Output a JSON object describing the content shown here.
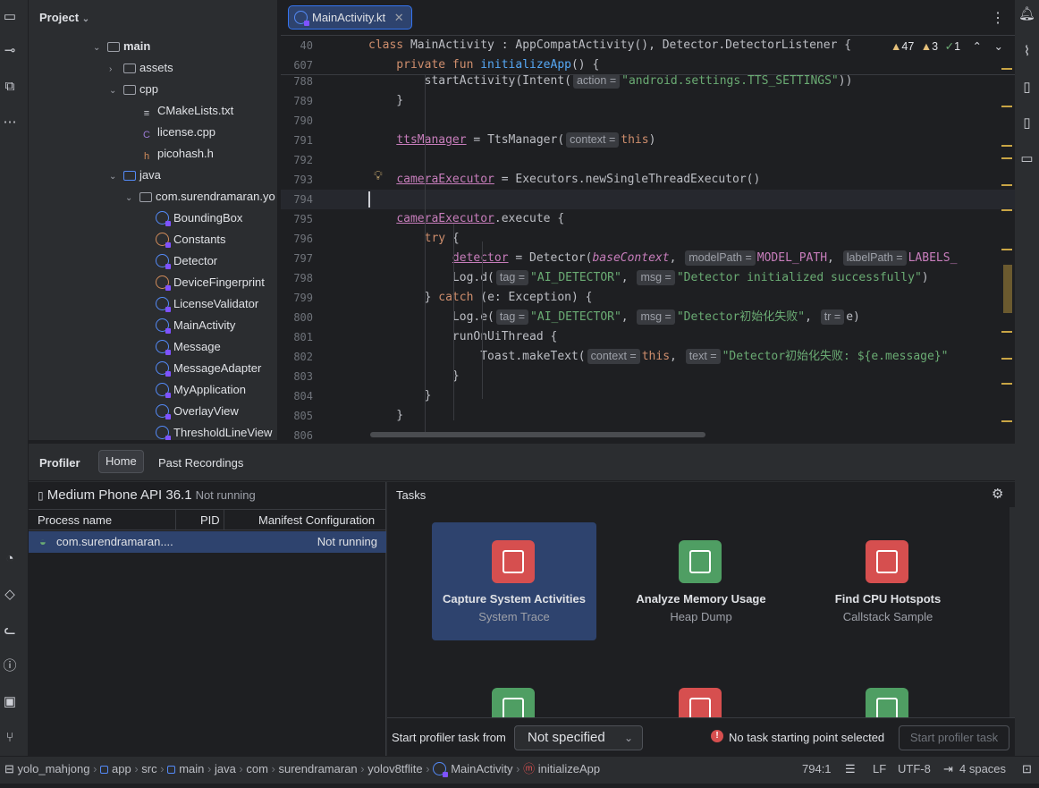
{
  "project_panel": {
    "title": "Project",
    "tree": [
      {
        "label": "main",
        "indent": 0,
        "arrow": "open",
        "icon": "module",
        "bold": true
      },
      {
        "label": "assets",
        "indent": 1,
        "arrow": "closed",
        "icon": "folder"
      },
      {
        "label": "cpp",
        "indent": 1,
        "arrow": "open",
        "icon": "folder"
      },
      {
        "label": "CMakeLists.txt",
        "indent": 2,
        "arrow": "",
        "icon": "text"
      },
      {
        "label": "license.cpp",
        "indent": 2,
        "arrow": "",
        "icon": "cpp"
      },
      {
        "label": "picohash.h",
        "indent": 2,
        "arrow": "",
        "icon": "header"
      },
      {
        "label": "java",
        "indent": 1,
        "arrow": "open",
        "icon": "folder-blue"
      },
      {
        "label": "com.surendramaran.yo",
        "indent": 2,
        "arrow": "open",
        "icon": "package"
      },
      {
        "label": "BoundingBox",
        "indent": 3,
        "arrow": "",
        "icon": "kotlin"
      },
      {
        "label": "Constants",
        "indent": 3,
        "arrow": "",
        "icon": "kotlin-object"
      },
      {
        "label": "Detector",
        "indent": 3,
        "arrow": "",
        "icon": "kotlin"
      },
      {
        "label": "DeviceFingerprint",
        "indent": 3,
        "arrow": "",
        "icon": "kotlin-object"
      },
      {
        "label": "LicenseValidator",
        "indent": 3,
        "arrow": "",
        "icon": "kotlin"
      },
      {
        "label": "MainActivity",
        "indent": 3,
        "arrow": "",
        "icon": "kotlin"
      },
      {
        "label": "Message",
        "indent": 3,
        "arrow": "",
        "icon": "kotlin"
      },
      {
        "label": "MessageAdapter",
        "indent": 3,
        "arrow": "",
        "icon": "kotlin"
      },
      {
        "label": "MyApplication",
        "indent": 3,
        "arrow": "",
        "icon": "kotlin"
      },
      {
        "label": "OverlayView",
        "indent": 3,
        "arrow": "",
        "icon": "kotlin"
      },
      {
        "label": "ThresholdLineView",
        "indent": 3,
        "arrow": "",
        "icon": "kotlin"
      }
    ]
  },
  "editor": {
    "tab_label": "MainActivity.kt",
    "inspections": {
      "warnings": "47",
      "weak_warnings": "3",
      "typos": "1"
    },
    "sticky": [
      {
        "num": "40",
        "parts": [
          [
            "kw",
            "class "
          ],
          [
            "cls",
            "MainActivity : AppCompatActivity(), Detector.DetectorListener {"
          ]
        ]
      },
      {
        "num": "607",
        "parts": [
          [
            "kw",
            "    private fun "
          ],
          [
            "fn",
            "initializeApp"
          ],
          [
            "cls",
            "() {"
          ]
        ]
      }
    ],
    "lines": [
      {
        "num": "788",
        "parts": [
          [
            "cls",
            "        startActivity(Intent("
          ],
          [
            "hint",
            "action ="
          ],
          [
            "str",
            "\"android.settings.TTS_SETTINGS\""
          ],
          [
            "cls",
            "))"
          ]
        ]
      },
      {
        "num": "789",
        "parts": [
          [
            "cls",
            "    }"
          ]
        ]
      },
      {
        "num": "790",
        "parts": []
      },
      {
        "num": "791",
        "parts": [
          [
            "cls",
            "    "
          ],
          [
            "prop",
            "ttsManager"
          ],
          [
            "cls",
            " = TtsManager("
          ],
          [
            "hint",
            "context ="
          ],
          [
            "kw",
            "this"
          ],
          [
            "cls",
            ")"
          ]
        ]
      },
      {
        "num": "792",
        "parts": []
      },
      {
        "num": "793",
        "parts": [
          [
            "cls",
            "    "
          ],
          [
            "prop",
            "cameraExecutor"
          ],
          [
            "cls",
            " = Executors.newSingleThreadExecutor()"
          ]
        ]
      },
      {
        "num": "794",
        "parts": []
      },
      {
        "num": "795",
        "parts": [
          [
            "cls",
            "    "
          ],
          [
            "prop",
            "cameraExecutor"
          ],
          [
            "cls",
            ".execute {"
          ]
        ]
      },
      {
        "num": "796",
        "parts": [
          [
            "kw",
            "        try "
          ],
          [
            "cls",
            "{"
          ]
        ]
      },
      {
        "num": "797",
        "parts": [
          [
            "cls",
            "            "
          ],
          [
            "prop",
            "detector"
          ],
          [
            "cls",
            " = Detector("
          ],
          [
            "it",
            "baseContext"
          ],
          [
            "cls",
            ", "
          ],
          [
            "hint",
            "modelPath ="
          ],
          [
            "const",
            "MODEL_PATH"
          ],
          [
            "cls",
            ", "
          ],
          [
            "hint",
            "labelPath ="
          ],
          [
            "const",
            "LABELS_"
          ]
        ]
      },
      {
        "num": "798",
        "parts": [
          [
            "cls",
            "            Log.d("
          ],
          [
            "hint",
            "tag ="
          ],
          [
            "str",
            "\"AI_DETECTOR\""
          ],
          [
            "cls",
            ", "
          ],
          [
            "hint",
            "msg ="
          ],
          [
            "str",
            "\"Detector initialized successfully\""
          ],
          [
            "cls",
            ")"
          ]
        ]
      },
      {
        "num": "799",
        "parts": [
          [
            "cls",
            "        } "
          ],
          [
            "kw",
            "catch "
          ],
          [
            "cls",
            "(e: Exception) {"
          ]
        ]
      },
      {
        "num": "800",
        "parts": [
          [
            "cls",
            "            Log.e("
          ],
          [
            "hint",
            "tag ="
          ],
          [
            "str",
            "\"AI_DETECTOR\""
          ],
          [
            "cls",
            ", "
          ],
          [
            "hint",
            "msg ="
          ],
          [
            "str",
            "\"Detector初始化失败\""
          ],
          [
            "cls",
            ", "
          ],
          [
            "hint",
            "tr ="
          ],
          [
            "cls",
            "e)"
          ]
        ]
      },
      {
        "num": "801",
        "parts": [
          [
            "cls",
            "            runOnUiThread {"
          ]
        ]
      },
      {
        "num": "802",
        "parts": [
          [
            "cls",
            "                Toast.makeText("
          ],
          [
            "hint",
            "context ="
          ],
          [
            "kw",
            "this"
          ],
          [
            "cls",
            ", "
          ],
          [
            "hint",
            "text ="
          ],
          [
            "str",
            "\"Detector初始化失败: ${e.message}\""
          ]
        ]
      },
      {
        "num": "803",
        "parts": [
          [
            "cls",
            "            }"
          ]
        ]
      },
      {
        "num": "804",
        "parts": [
          [
            "cls",
            "        }"
          ]
        ]
      },
      {
        "num": "805",
        "parts": [
          [
            "cls",
            "    }"
          ]
        ]
      },
      {
        "num": "806",
        "parts": []
      }
    ]
  },
  "profiler": {
    "title": "Profiler",
    "tabs": [
      "Home",
      "Past Recordings"
    ],
    "device": "Medium Phone API 36.1",
    "device_status": "Not running",
    "columns": [
      "Process name",
      "PID",
      "Manifest Configuration"
    ],
    "process": {
      "name": "com.surendramaran....",
      "status": "Not running"
    },
    "tasks_title": "Tasks",
    "tasks": [
      {
        "title": "Capture System Activities",
        "subtitle": "System Trace",
        "color": "#d64f4f",
        "selected": true
      },
      {
        "title": "Analyze Memory Usage",
        "subtitle": "Heap Dump",
        "color": "#4f9e63",
        "selected": false
      },
      {
        "title": "Find CPU Hotspots",
        "subtitle": "Callstack Sample",
        "color": "#d64f4f",
        "selected": false
      },
      {
        "title": "",
        "subtitle": "",
        "color": "#4f9e63",
        "selected": false
      },
      {
        "title": "",
        "subtitle": "",
        "color": "#d64f4f",
        "selected": false
      },
      {
        "title": "",
        "subtitle": "",
        "color": "#4f9e63",
        "selected": false
      }
    ],
    "start_from_label": "Start profiler task from",
    "start_from_value": "Not specified",
    "warning": "No task starting point selected",
    "start_button": "Start profiler task"
  },
  "status_bar": {
    "breadcrumbs": [
      "yolo_mahjong",
      "app",
      "src",
      "main",
      "java",
      "com",
      "surendramaran",
      "yolov8tflite",
      "MainActivity",
      "initializeApp"
    ],
    "position": "794:1",
    "line_ending": "LF",
    "encoding": "UTF-8",
    "indent": "4 spaces"
  },
  "colors": {
    "accent": "#3574f0",
    "selection": "#2e436e",
    "error": "#d64f4f"
  }
}
